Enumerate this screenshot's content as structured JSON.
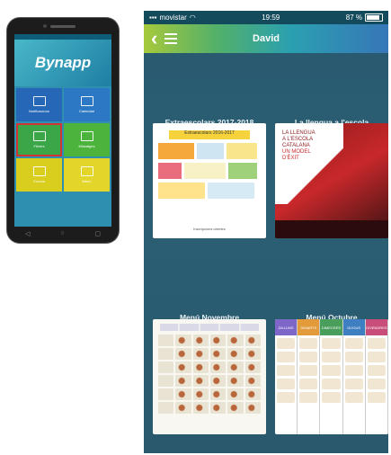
{
  "phone": {
    "logo": "Bynapp",
    "tiles": [
      {
        "label": "Notificacions",
        "color": "#2667b8"
      },
      {
        "label": "Calendari",
        "color": "#2d78c4"
      },
      {
        "label": "Fitxers",
        "color": "#3aa648",
        "selected": true
      },
      {
        "label": "Missatges",
        "color": "#4cb33c"
      },
      {
        "label": "Cursos",
        "color": "#d9cd1e"
      },
      {
        "label": "Menú",
        "color": "#e4d52a"
      }
    ],
    "nav": [
      "◁",
      "○",
      "▢"
    ]
  },
  "app": {
    "status": {
      "carrier": "movistar",
      "wifi": "wifi-icon",
      "time": "19:59",
      "battery": "87 %",
      "battery_level": 0.87
    },
    "header": {
      "back_icon": "back-arrow-icon",
      "menu_icon": "hamburger-menu-icon",
      "title": "David",
      "gradient": [
        "#a7c93c",
        "#52b06a",
        "#2aa0b0",
        "#3776b8"
      ]
    },
    "documents": [
      {
        "title": "Extraescolars 2017-2018",
        "poster_heading": "Extraescolars 2016-2017",
        "footer": "Inscripcions obertes"
      },
      {
        "title": "La llengua a l'escola",
        "line1": "LA LLENGUA",
        "line2": "A L'ESCOLA",
        "line3": "CATALANA",
        "line4": "UN MODEL",
        "line5": "D'ÈXIT"
      },
      {
        "title": "Menú Novembre"
      },
      {
        "title": "Menú Octubre",
        "days": [
          "DILLUNS",
          "DIMARTS",
          "DIMECRES",
          "DIJOUS",
          "DIVENDRES"
        ],
        "day_colors": [
          "#7f67c9",
          "#e29a3a",
          "#4a9e5c",
          "#3e7fc2",
          "#c94d7a"
        ]
      }
    ]
  }
}
